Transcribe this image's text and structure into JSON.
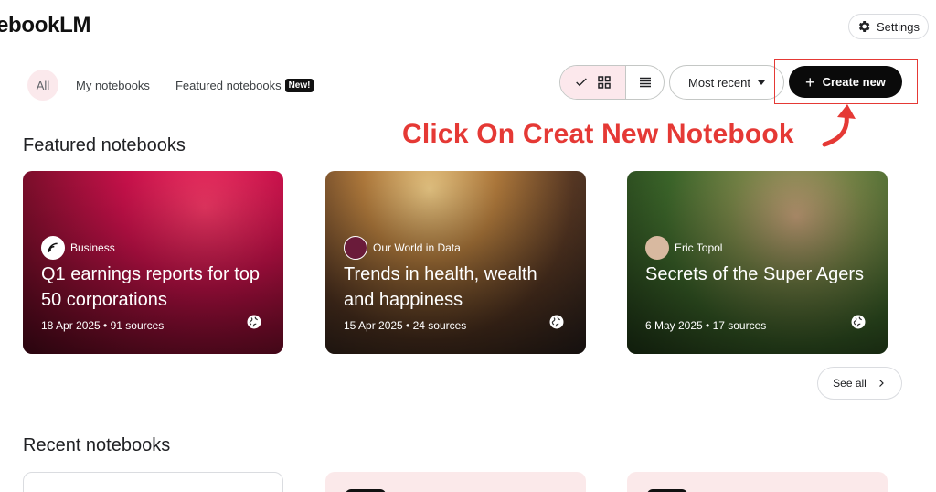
{
  "app": {
    "title": "ebookLM"
  },
  "header": {
    "settings_label": "Settings",
    "settings_icon": "gear-icon"
  },
  "filters": {
    "all": "All",
    "my_notebooks": "My notebooks",
    "featured_notebooks": "Featured notebooks",
    "new_badge": "New!"
  },
  "toolbar": {
    "view_grid_icon": "grid-icon",
    "view_list_icon": "list-icon",
    "sort_label": "Most recent",
    "create_label": "Create new"
  },
  "annotation": {
    "text": "Click On Creat New Notebook",
    "color": "#e53935"
  },
  "featured": {
    "title": "Featured notebooks",
    "cards": [
      {
        "source": "Business",
        "title": "Q1 earnings reports for top 50 corporations",
        "meta": "18 Apr 2025 • 91 sources",
        "avatar_text": ""
      },
      {
        "source": "Our World in Data",
        "title": "Trends in health, wealth and happiness",
        "meta": "15 Apr 2025 • 24 sources",
        "avatar_text": ""
      },
      {
        "source": "Eric Topol",
        "title": "Secrets of the Super Agers",
        "meta": "6 May 2025 • 17 sources",
        "avatar_text": ""
      }
    ],
    "see_all": "See all"
  },
  "recent": {
    "title": "Recent notebooks"
  },
  "colors": {
    "accent": "#0a0a0a",
    "chip_bg": "#fbe9ec",
    "annotation_red": "#e53935"
  }
}
